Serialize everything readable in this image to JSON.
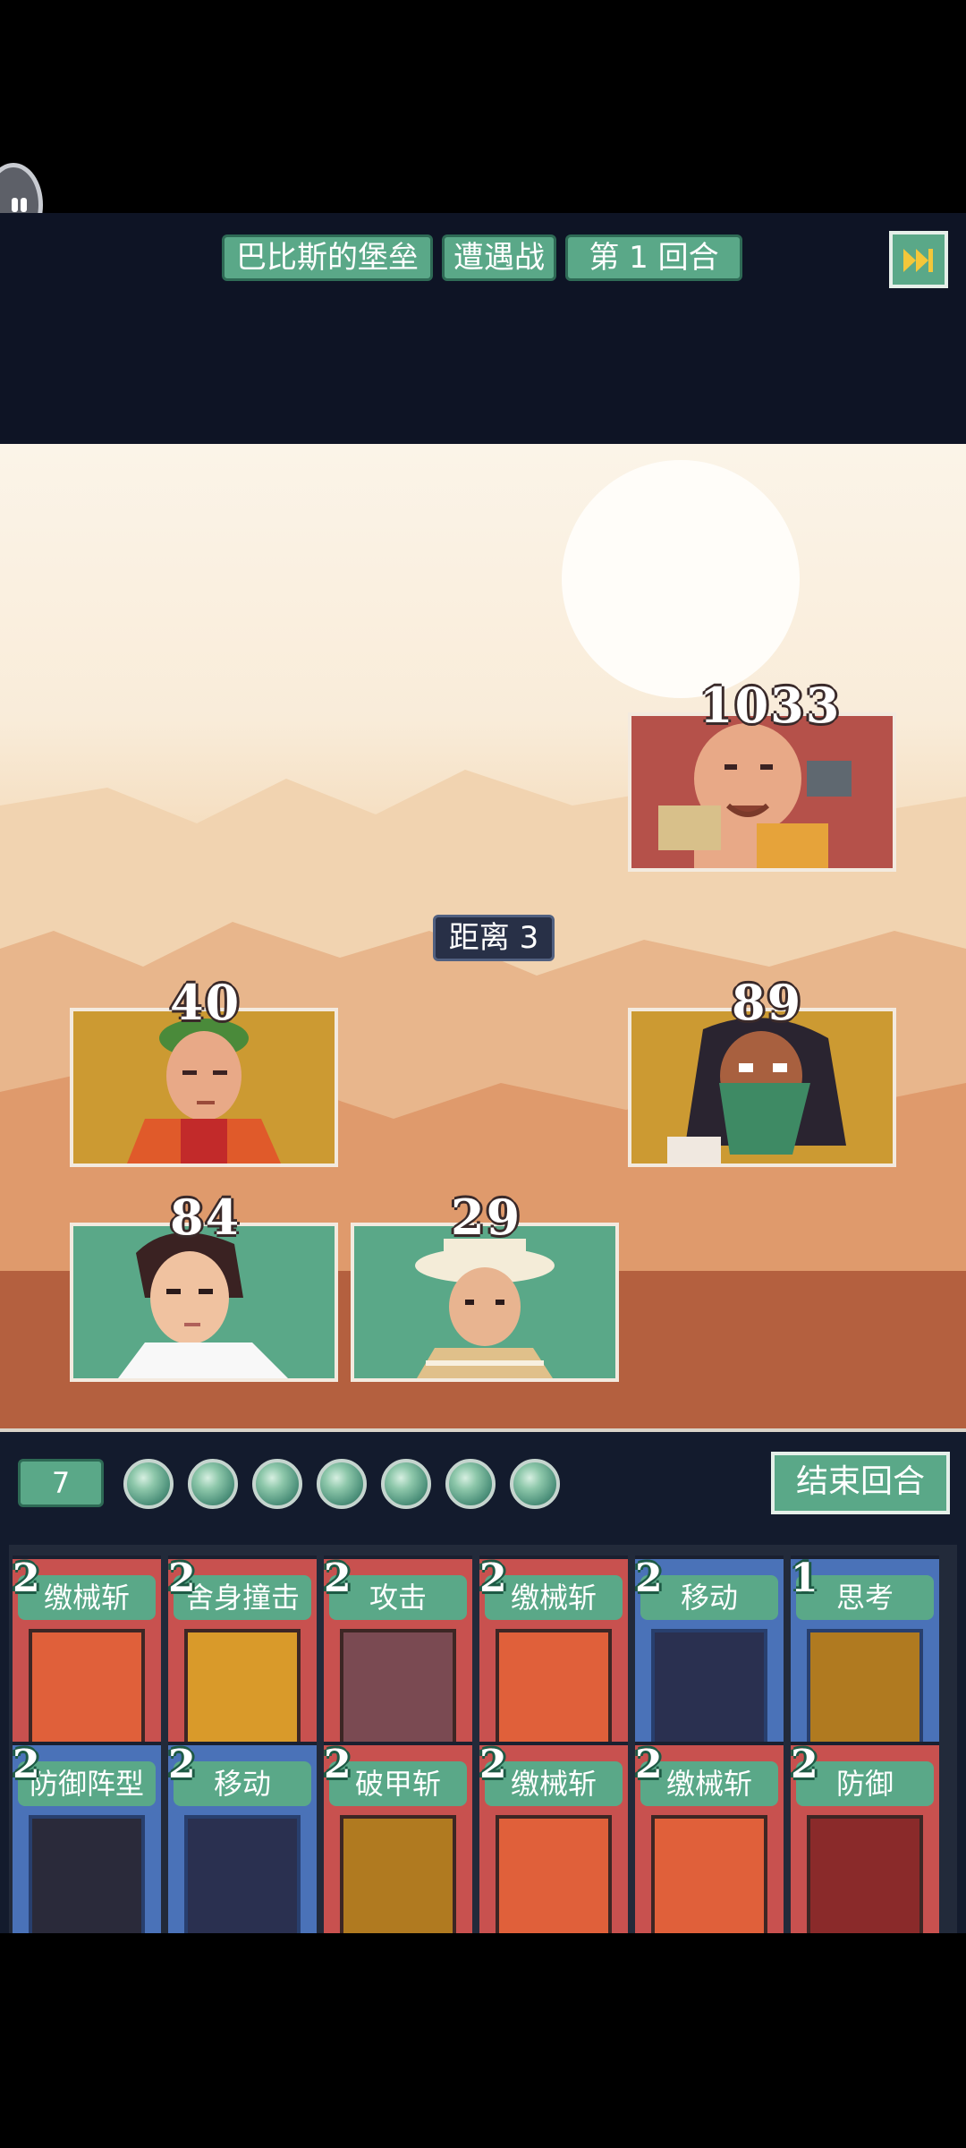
{
  "header": {
    "location": "巴比斯的堡垒",
    "battle_type": "遭遇战",
    "turn": "第 1 回合"
  },
  "units": {
    "enemy_boss": {
      "hp": "1033"
    },
    "enemy_masked": {
      "hp": "89"
    },
    "ally_green_hair": {
      "hp": "40"
    },
    "ally_hero": {
      "hp": "84"
    },
    "ally_hat": {
      "hp": "29"
    }
  },
  "distance_label": "距离 3",
  "energy": {
    "value": "7",
    "orbs": 7
  },
  "end_turn_label": "结束回合",
  "hand": {
    "row1": [
      {
        "cost": "2",
        "name": "缴械斩",
        "color": "red"
      },
      {
        "cost": "2",
        "name": "舍身撞击",
        "color": "red"
      },
      {
        "cost": "2",
        "name": "攻击",
        "color": "red"
      },
      {
        "cost": "2",
        "name": "缴械斩",
        "color": "red"
      },
      {
        "cost": "2",
        "name": "移动",
        "color": "blue"
      },
      {
        "cost": "1",
        "name": "思考",
        "color": "blue"
      }
    ],
    "row2": [
      {
        "cost": "2",
        "name": "防御阵型",
        "color": "blue"
      },
      {
        "cost": "2",
        "name": "移动",
        "color": "blue"
      },
      {
        "cost": "2",
        "name": "破甲斩",
        "color": "red"
      },
      {
        "cost": "2",
        "name": "缴械斩",
        "color": "red"
      },
      {
        "cost": "2",
        "name": "缴械斩",
        "color": "red"
      },
      {
        "cost": "2",
        "name": "防御",
        "color": "red"
      }
    ]
  },
  "colors": {
    "accent_green": "#5aa888",
    "card_red": "#c8514f",
    "card_blue": "#4a72b8",
    "panel_navy": "#0e1425"
  }
}
